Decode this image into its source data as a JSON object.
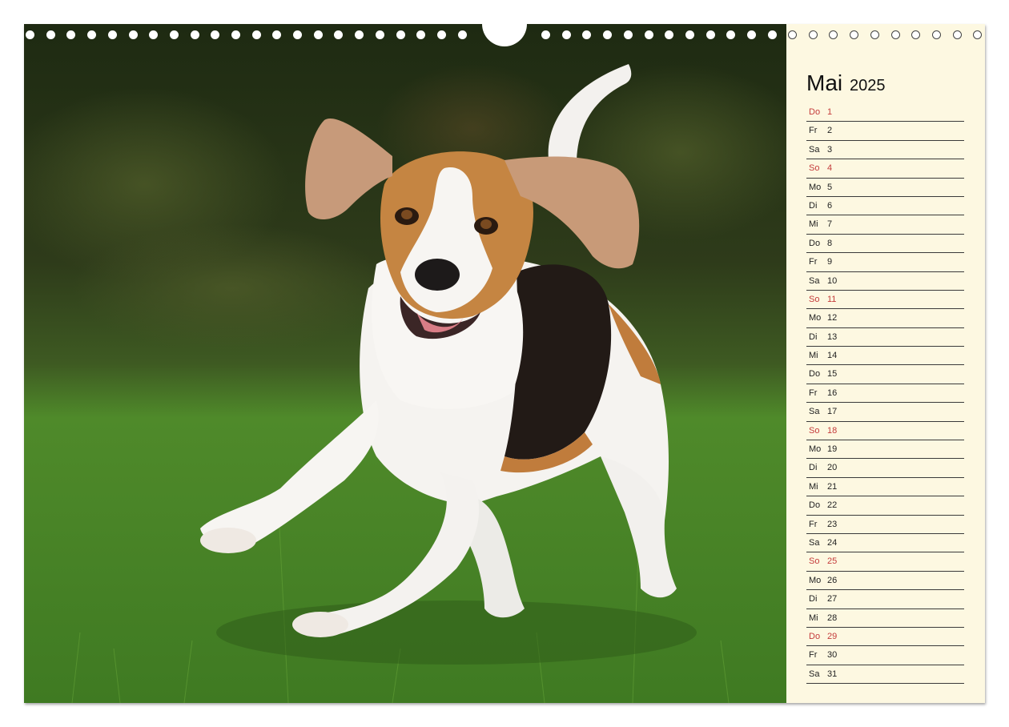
{
  "calendar": {
    "month": "Mai",
    "year": "2025",
    "days": [
      {
        "dn": "Do",
        "d": "1",
        "holiday": true
      },
      {
        "dn": "Fr",
        "d": "2",
        "holiday": false
      },
      {
        "dn": "Sa",
        "d": "3",
        "holiday": false
      },
      {
        "dn": "So",
        "d": "4",
        "holiday": true
      },
      {
        "dn": "Mo",
        "d": "5",
        "holiday": false
      },
      {
        "dn": "Di",
        "d": "6",
        "holiday": false
      },
      {
        "dn": "Mi",
        "d": "7",
        "holiday": false
      },
      {
        "dn": "Do",
        "d": "8",
        "holiday": false
      },
      {
        "dn": "Fr",
        "d": "9",
        "holiday": false
      },
      {
        "dn": "Sa",
        "d": "10",
        "holiday": false
      },
      {
        "dn": "So",
        "d": "11",
        "holiday": true
      },
      {
        "dn": "Mo",
        "d": "12",
        "holiday": false
      },
      {
        "dn": "Di",
        "d": "13",
        "holiday": false
      },
      {
        "dn": "Mi",
        "d": "14",
        "holiday": false
      },
      {
        "dn": "Do",
        "d": "15",
        "holiday": false
      },
      {
        "dn": "Fr",
        "d": "16",
        "holiday": false
      },
      {
        "dn": "Sa",
        "d": "17",
        "holiday": false
      },
      {
        "dn": "So",
        "d": "18",
        "holiday": true
      },
      {
        "dn": "Mo",
        "d": "19",
        "holiday": false
      },
      {
        "dn": "Di",
        "d": "20",
        "holiday": false
      },
      {
        "dn": "Mi",
        "d": "21",
        "holiday": false
      },
      {
        "dn": "Do",
        "d": "22",
        "holiday": false
      },
      {
        "dn": "Fr",
        "d": "23",
        "holiday": false
      },
      {
        "dn": "Sa",
        "d": "24",
        "holiday": false
      },
      {
        "dn": "So",
        "d": "25",
        "holiday": true
      },
      {
        "dn": "Mo",
        "d": "26",
        "holiday": false
      },
      {
        "dn": "Di",
        "d": "27",
        "holiday": false
      },
      {
        "dn": "Mi",
        "d": "28",
        "holiday": false
      },
      {
        "dn": "Do",
        "d": "29",
        "holiday": true
      },
      {
        "dn": "Fr",
        "d": "30",
        "holiday": false
      },
      {
        "dn": "Sa",
        "d": "31",
        "holiday": false
      }
    ]
  },
  "colors": {
    "panel_background": "#fdf8e1",
    "holiday_text": "#c43b3b",
    "rule_line": "#3a3a3a"
  }
}
